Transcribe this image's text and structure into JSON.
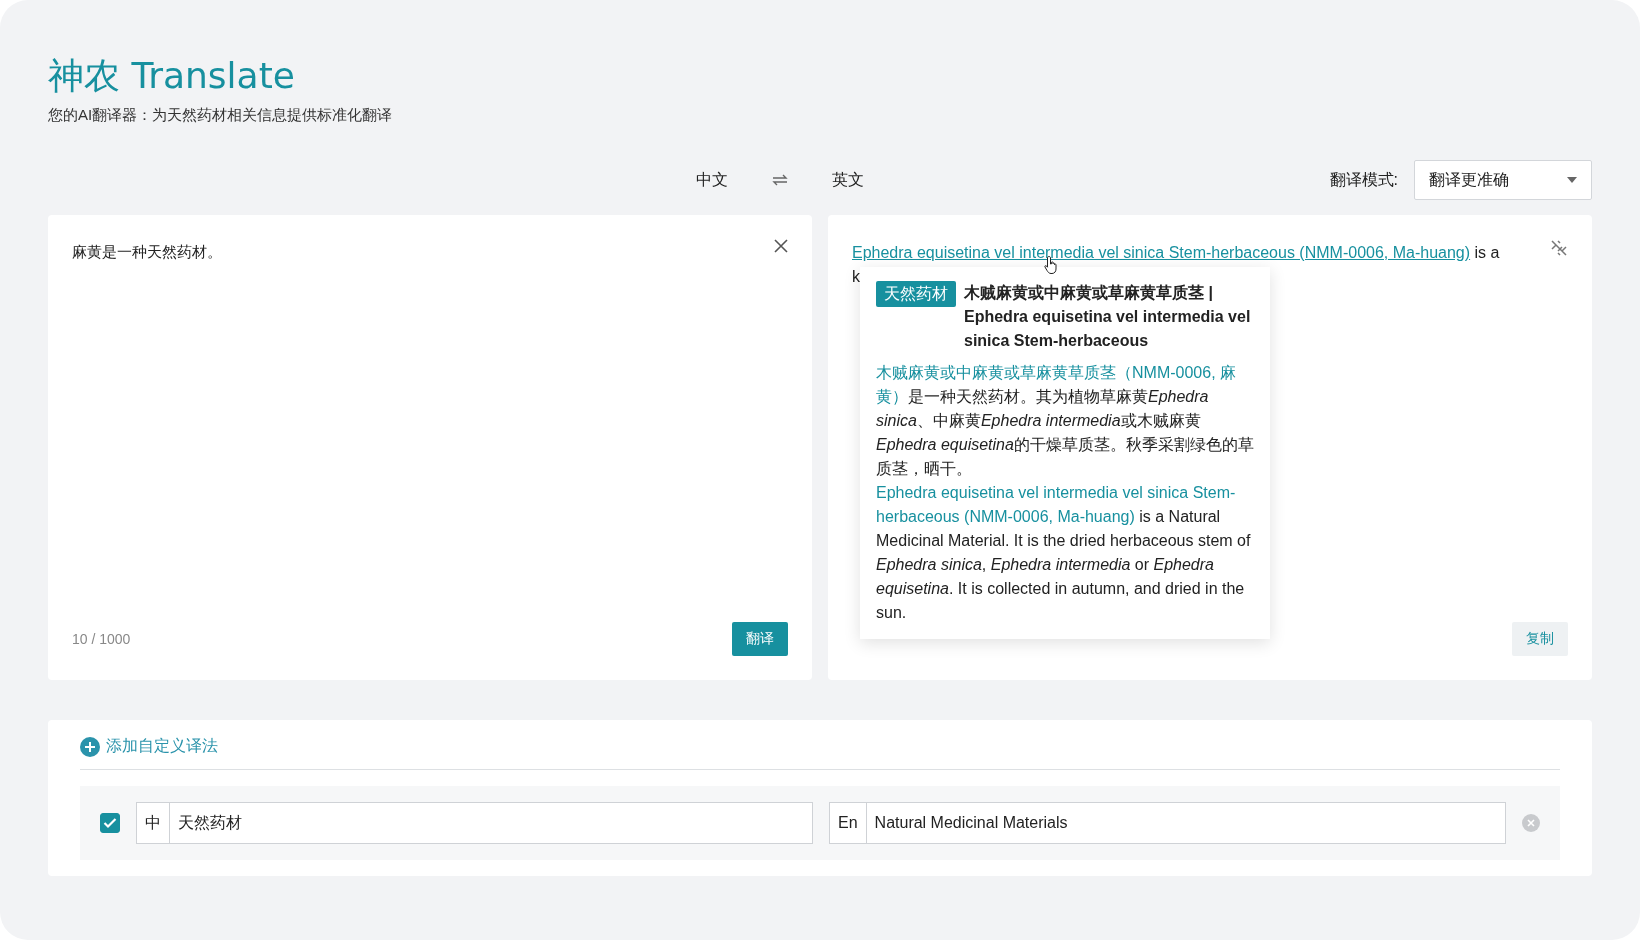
{
  "header": {
    "title": "神农 Translate",
    "subtitle": "您的AI翻译器：为天然药材相关信息提供标准化翻译"
  },
  "languages": {
    "source": "中文",
    "target": "英文"
  },
  "mode": {
    "label": "翻译模式:",
    "value": "翻译更准确"
  },
  "input_panel": {
    "text": "麻黄是一种天然药材。",
    "counter": "10 / 1000",
    "button": "翻译"
  },
  "output_panel": {
    "link": "Ephedra equisetina vel intermedia vel sinica Stem-herbaceous (NMM-0006, Ma-huang)",
    "tail": "is a",
    "line_2": "k",
    "button": "复制"
  },
  "popup": {
    "tag": "天然药材",
    "title": "木贼麻黄或中麻黄或草麻黄草质茎 | Ephedra equisetina vel intermedia vel sinica Stem-herbaceous",
    "paragraphs": [
      {
        "term": "木贼麻黄或中麻黄或草麻黄草质茎（NMM-0006, 麻黄）",
        "segments": [
          {
            "text": "是一种天然药材。其为植物草麻黄",
            "italic": false
          },
          {
            "text": "Ephedra sinica",
            "italic": true
          },
          {
            "text": "、中麻黄",
            "italic": false
          },
          {
            "text": "Ephedra intermedia",
            "italic": true
          },
          {
            "text": "或木贼麻黄",
            "italic": false
          },
          {
            "text": "Ephedra equisetina",
            "italic": true
          },
          {
            "text": "的干燥草质茎。秋季采割绿色的草质茎，晒干。",
            "italic": false
          }
        ]
      },
      {
        "term": "Ephedra equisetina vel intermedia vel sinica Stem-herbaceous (NMM-0006, Ma-huang)",
        "segments": [
          {
            "text": " is a Natural Medicinal Material. It is the dried herbaceous stem of ",
            "italic": false
          },
          {
            "text": "Ephedra sinica",
            "italic": true
          },
          {
            "text": ", ",
            "italic": false
          },
          {
            "text": "Ephedra intermedia",
            "italic": true
          },
          {
            "text": " or ",
            "italic": false
          },
          {
            "text": "Ephedra equisetina",
            "italic": true
          },
          {
            "text": ". It is collected in autumn, and dried in the sun.",
            "italic": false
          }
        ]
      }
    ]
  },
  "custom": {
    "add_label": "添加自定义译法",
    "entries": [
      {
        "checked": true,
        "source_prefix": "中",
        "source": "天然药材",
        "target_prefix": "En",
        "target": "Natural Medicinal Materials"
      }
    ]
  }
}
